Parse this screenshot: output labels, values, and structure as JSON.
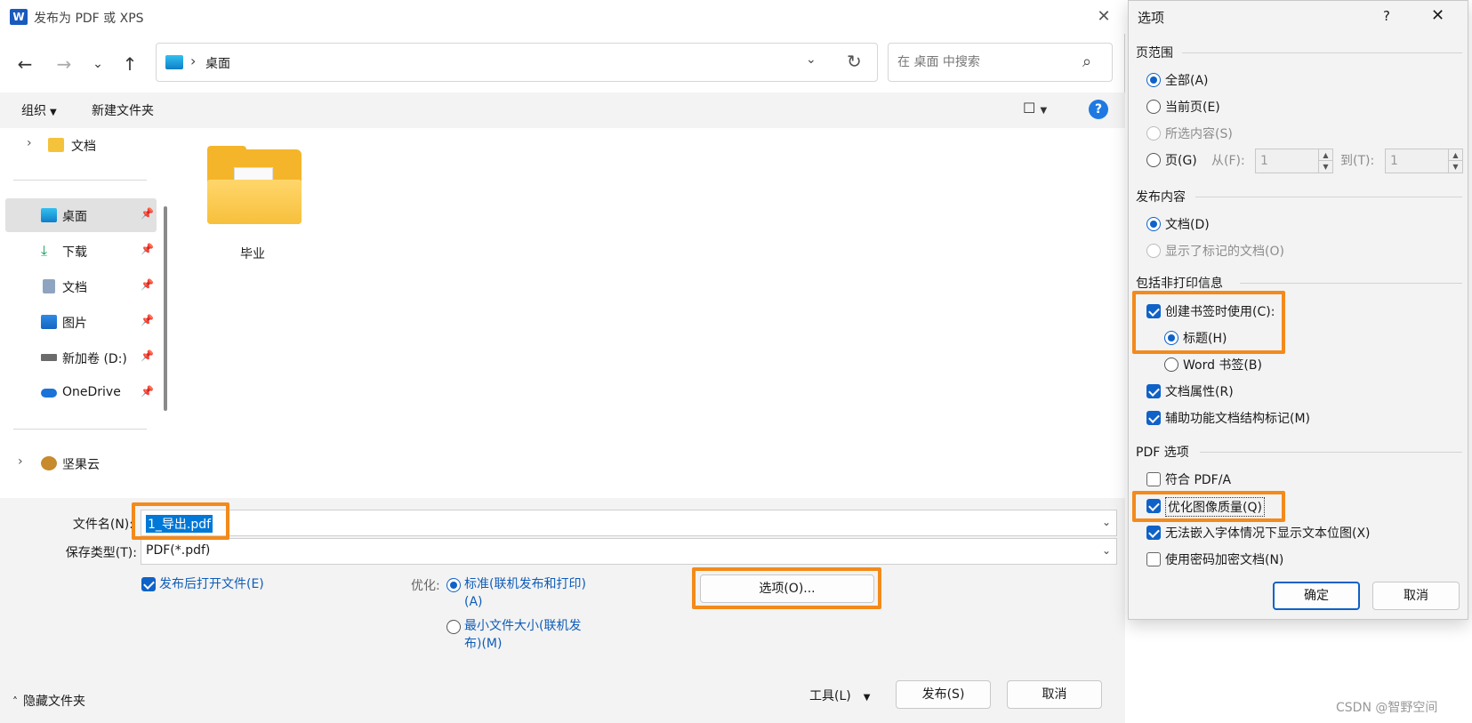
{
  "main_dialog": {
    "title": "发布为 PDF 或 XPS",
    "logo_letter": "W",
    "close_glyph": "✕",
    "address": {
      "location": "桌面",
      "separator": "›"
    },
    "search": {
      "placeholder": "在 桌面 中搜索"
    },
    "commands": {
      "organize": "组织",
      "new_folder": "新建文件夹"
    },
    "nav": [
      {
        "label": "文档",
        "icon": "folder-icon"
      },
      {
        "label": "桌面",
        "icon": "desktop-icon"
      },
      {
        "label": "下载",
        "icon": "download-icon"
      },
      {
        "label": "文档",
        "icon": "document-icon"
      },
      {
        "label": "图片",
        "icon": "pictures-icon"
      },
      {
        "label": "新加卷 (D:)",
        "icon": "drive-icon"
      },
      {
        "label": "OneDrive",
        "icon": "cloud-icon"
      },
      {
        "label": "坚果云",
        "icon": "nutstore-icon"
      }
    ],
    "files": [
      {
        "name": "毕业",
        "type": "folder"
      }
    ],
    "filename_label": "文件名(N):",
    "filename_value": "1_导出.pdf",
    "filetype_label": "保存类型(T):",
    "filetype_value": "PDF(*.pdf)",
    "open_after": "发布后打开文件(E)",
    "optimize_label": "优化:",
    "optimize_standard": "标准(联机发布和打印)(A)",
    "optimize_min": "最小文件大小(联机发布)(M)",
    "options_button": "选项(O)...",
    "hide_folders": "隐藏文件夹",
    "tools": "工具(L)",
    "publish": "发布(S)",
    "cancel": "取消"
  },
  "options_dialog": {
    "title": "选项",
    "help": "?",
    "close": "✕",
    "page_range": {
      "label": "页范围",
      "all": "全部(A)",
      "current": "当前页(E)",
      "selection": "所选内容(S)",
      "pages": "页(G)",
      "from_label": "从(F):",
      "from_value": "1",
      "to_label": "到(T):",
      "to_value": "1",
      "selected": "all"
    },
    "publish_what": {
      "label": "发布内容",
      "document": "文档(D)",
      "document_markup": "显示了标记的文档(O)"
    },
    "non_print": {
      "label": "包括非打印信息",
      "create_bookmarks": "创建书签时使用(C):",
      "headings": "标题(H)",
      "word_bookmarks": "Word 书签(B)",
      "doc_properties": "文档属性(R)",
      "accessibility_tags": "辅助功能文档结构标记(M)"
    },
    "pdf_options": {
      "label": "PDF 选项",
      "pdfa": "符合 PDF/A",
      "optimize_image": "优化图像质量(Q)",
      "bitmap_text": "无法嵌入字体情况下显示文本位图(X)",
      "encrypt": "使用密码加密文档(N)"
    },
    "ok": "确定",
    "cancel": "取消"
  },
  "colors": {
    "accent": "#0f62c7",
    "highlight": "#f38a1b",
    "folder": "#f5b52a"
  },
  "watermark": "CSDN @智野空间"
}
